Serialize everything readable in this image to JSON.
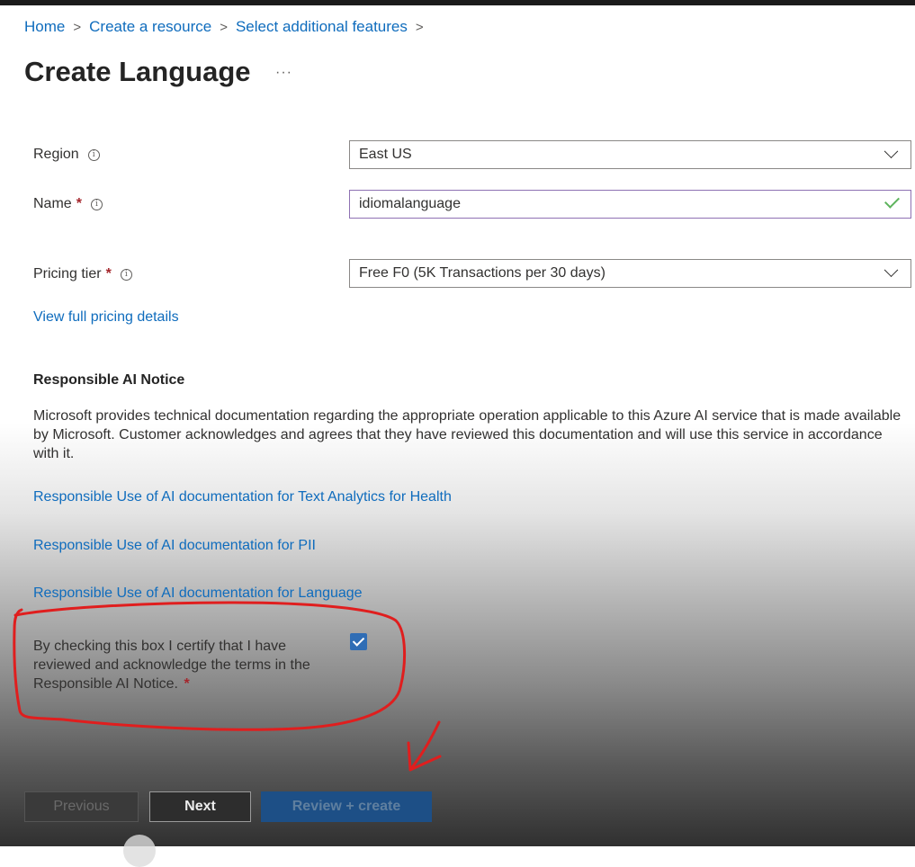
{
  "breadcrumb": {
    "items": [
      "Home",
      "Create a resource",
      "Select additional features"
    ],
    "separator": ">"
  },
  "page": {
    "title": "Create Language",
    "more": "···"
  },
  "form": {
    "region": {
      "label": "Region",
      "value": "East US"
    },
    "name": {
      "label": "Name",
      "required": "*",
      "value": "idiomalanguage"
    },
    "pricing": {
      "label": "Pricing tier",
      "required": "*",
      "value": "Free F0 (5K Transactions per 30 days)"
    },
    "pricing_link": "View full pricing details",
    "info_glyph": "i"
  },
  "notice": {
    "heading": "Responsible AI Notice",
    "body": "Microsoft provides technical documentation regarding the appropriate operation applicable to this Azure AI service that is made available by Microsoft. Customer acknowledges and agrees that they have reviewed this documentation and will use this service in accordance with it.",
    "links": [
      "Responsible Use of AI documentation for Text Analytics for Health",
      "Responsible Use of AI documentation for PII",
      "Responsible Use of AI documentation for Language"
    ],
    "ack_text": "By checking this box I certify that I have reviewed and acknowledge the terms in the Responsible AI Notice.",
    "ack_required": "*",
    "ack_checked": true
  },
  "footer": {
    "previous": "Previous",
    "next": "Next",
    "review": "Review + create"
  },
  "colors": {
    "link": "#0f6cbd",
    "required": "#a4262c",
    "checkbox": "#2f6db5",
    "annotation": "#e01e1e"
  }
}
